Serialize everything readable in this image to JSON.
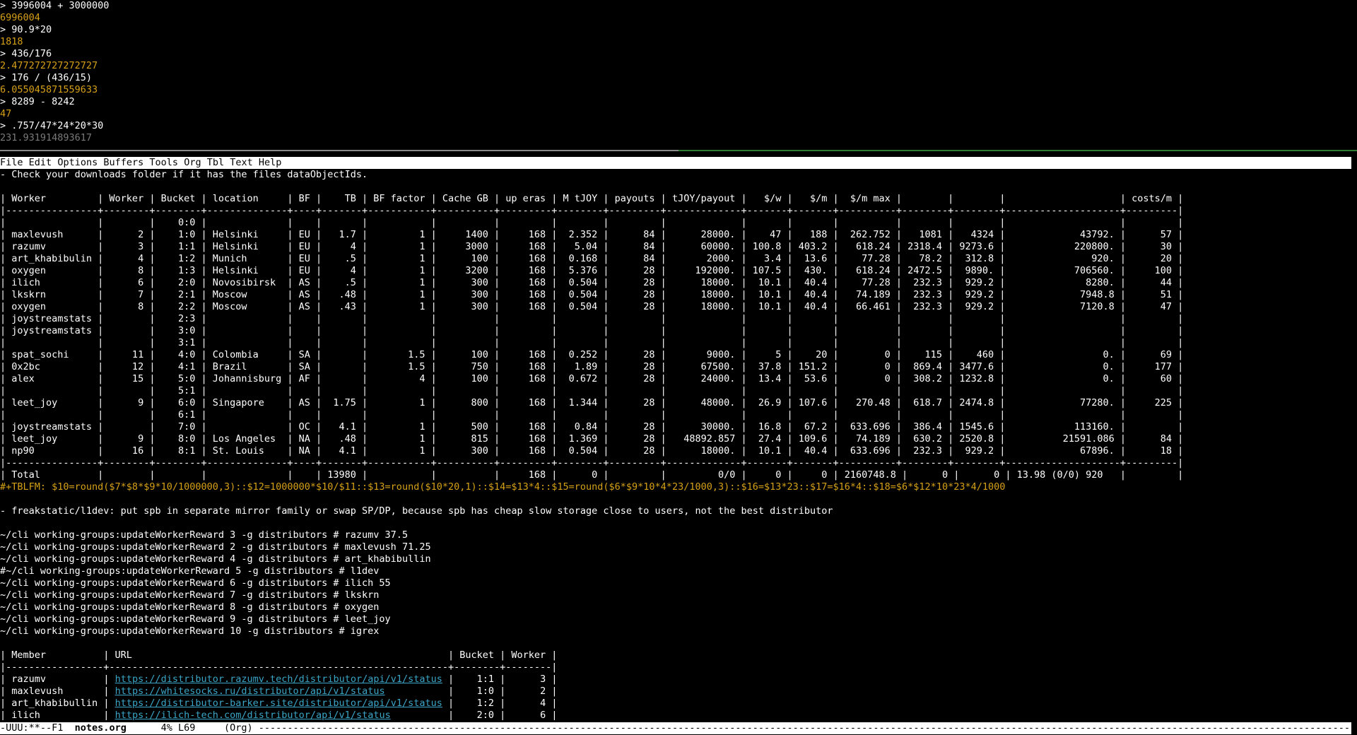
{
  "terminal": {
    "lines": [
      {
        "text": "> 3996004 + 3000000",
        "kind": "cmd"
      },
      {
        "text": "6996004",
        "kind": "out"
      },
      {
        "text": "> 90.9*20",
        "kind": "cmd"
      },
      {
        "text": "1818",
        "kind": "out"
      },
      {
        "text": "> 436/176",
        "kind": "cmd"
      },
      {
        "text": "2.477272727272727",
        "kind": "out"
      },
      {
        "text": "> 176 / (436/15)",
        "kind": "cmd"
      },
      {
        "text": "6.055045871559633",
        "kind": "out"
      },
      {
        "text": "> 8289 - 8242",
        "kind": "cmd"
      },
      {
        "text": "47",
        "kind": "out"
      },
      {
        "text": "> .757/47*24*20*30",
        "kind": "cmd"
      },
      {
        "text": "231.931914893617",
        "kind": "dim"
      }
    ]
  },
  "menubar": {
    "items": [
      "File",
      "Edit",
      "Options",
      "Buffers",
      "Tools",
      "Org",
      "Tbl",
      "Text",
      "Help"
    ]
  },
  "buffer": {
    "lines": [
      {
        "text": "- Check your downloads folder if it has the files dataObjectIds.",
        "kind": "text"
      },
      {
        "text": "",
        "kind": "text"
      },
      {
        "text": "| Worker         | Worker | Bucket | location     | BF |    TB | BF factor | Cache GB | up eras | M tJOY | payouts | tJOY/payout |   $/w |   $/m |  $/m max |        |        |                    | costs/m |",
        "kind": "tbl"
      },
      {
        "text": "|----------------+--------+--------+--------------+----+-------+-----------+----------+---------+--------+---------+-------------+-------+-------+----------+--------+--------+--------------------+---------|",
        "kind": "tbl"
      },
      {
        "text": "|                |        |    0:0 |              |    |       |           |          |         |        |         |             |       |       |          |        |        |                    |         |",
        "kind": "tbl"
      },
      {
        "text": "| maxlevush      |      2 |    1:0 | Helsinki     | EU |   1.7 |         1 |     1400 |     168 |  2.352 |      84 |      28000. |    47 |   188 |  262.752 |   1081 |   4324 |             43792. |      57 |",
        "kind": "tbl"
      },
      {
        "text": "| razumv         |      3 |    1:1 | Helsinki     | EU |     4 |         1 |     3000 |     168 |   5.04 |      84 |      60000. | 100.8 | 403.2 |   618.24 | 2318.4 | 9273.6 |            220800. |      30 |",
        "kind": "tbl"
      },
      {
        "text": "| art_khabibulin |      4 |    1:2 | Munich       | EU |    .5 |         1 |      100 |     168 |  0.168 |      84 |       2000. |   3.4 |  13.6 |    77.28 |   78.2 |  312.8 |               920. |      20 |",
        "kind": "tbl"
      },
      {
        "text": "| oxygen         |      8 |    1:3 | Helsinki     | EU |     4 |         1 |     3200 |     168 |  5.376 |      28 |     192000. | 107.5 |  430. |   618.24 | 2472.5 |  9890. |            706560. |     100 |",
        "kind": "tbl"
      },
      {
        "text": "| ilich          |      6 |    2:0 | Novosibirsk  | AS |    .5 |         1 |      300 |     168 |  0.504 |      28 |      18000. |  10.1 |  40.4 |    77.28 |  232.3 |  929.2 |              8280. |      44 |",
        "kind": "tbl"
      },
      {
        "text": "| lkskrn         |      7 |    2:1 | Moscow       | AS |   .48 |         1 |      300 |     168 |  0.504 |      28 |      18000. |  10.1 |  40.4 |   74.189 |  232.3 |  929.2 |             7948.8 |      51 |",
        "kind": "tbl"
      },
      {
        "text": "| oxygen         |      8 |    2:2 | Moscow       | AS |   .43 |         1 |      300 |     168 |  0.504 |      28 |      18000. |  10.1 |  40.4 |   66.461 |  232.3 |  929.2 |             7120.8 |      47 |",
        "kind": "tbl"
      },
      {
        "text": "| joystreamstats |        |    2:3 |              |    |       |           |          |         |        |         |             |       |       |          |        |        |                    |         |",
        "kind": "tbl"
      },
      {
        "text": "| joystreamstats |        |    3:0 |              |    |       |           |          |         |        |         |             |       |       |          |        |        |                    |         |",
        "kind": "tbl"
      },
      {
        "text": "|                |        |    3:1 |              |    |       |           |          |         |        |         |             |       |       |          |        |        |                    |         |",
        "kind": "tbl"
      },
      {
        "text": "| spat_sochi     |     11 |    4:0 | Colombia     | SA |       |       1.5 |      100 |     168 |  0.252 |      28 |       9000. |     5 |    20 |        0 |    115 |    460 |                 0. |      69 |",
        "kind": "tbl"
      },
      {
        "text": "| 0x2bc          |     12 |    4:1 | Brazil       | SA |       |       1.5 |      750 |     168 |   1.89 |      28 |      67500. |  37.8 | 151.2 |        0 |  869.4 | 3477.6 |                 0. |     177 |",
        "kind": "tbl"
      },
      {
        "text": "| alex           |     15 |    5:0 | Johannisburg | AF |       |         4 |      100 |     168 |  0.672 |      28 |      24000. |  13.4 |  53.6 |        0 |  308.2 | 1232.8 |                 0. |      60 |",
        "kind": "tbl"
      },
      {
        "text": "|                |        |    5:1 |              |    |       |           |          |         |        |         |             |       |       |          |        |        |                    |         |",
        "kind": "tbl"
      },
      {
        "text": "| leet_joy       |      9 |    6:0 | Singapore    | AS |  1.75 |         1 |      800 |     168 |  1.344 |      28 |      48000. |  26.9 | 107.6 |   270.48 |  618.7 | 2474.8 |             77280. |     225 |",
        "kind": "tbl"
      },
      {
        "text": "|                |        |    6:1 |              |    |       |           |          |         |        |         |             |       |       |          |        |        |                    |         |",
        "kind": "tbl"
      },
      {
        "text": "| joystreamstats |        |    7:0 |              | OC |   4.1 |         1 |      500 |     168 |   0.84 |      28 |      30000. |  16.8 |  67.2 |  633.696 |  386.4 | 1545.6 |            113160. |         |",
        "kind": "tbl"
      },
      {
        "text": "| leet_joy       |      9 |    8:0 | Los Angeles  | NA |   .48 |         1 |      815 |     168 |  1.369 |      28 |   48892.857 |  27.4 | 109.6 |   74.189 |  630.2 | 2520.8 |          21591.086 |      84 |",
        "kind": "tbl"
      },
      {
        "text": "| np90           |     16 |    8:1 | St. Louis    | NA |   4.1 |         1 |      300 |     168 |  0.504 |      28 |      18000. |  10.1 |  40.4 |  633.696 |  232.3 |  929.2 |             67896. |      18 |",
        "kind": "tbl"
      },
      {
        "text": "|----------------+--------+--------+--------------+----+-------+-----------+----------+---------+--------+---------+-------------+-------+-------+----------+--------+--------+--------------------+---------|",
        "kind": "tbl"
      },
      {
        "text": "| Total          |        |        |              |    | 13980 |           |          |     168 |      0 |         |         0/0 |     0 |     0 | 2160748.8 |      0 |      0 | 13.98 (0/0) 920   |         |",
        "kind": "tbl"
      },
      {
        "text": "#+TBLFM: $10=round($7*$8*$9*10/1000000,3)::$12=1000000*$10/$11::$13=round($10*20,1)::$14=$13*4::$15=round($6*$9*10*4*23/1000,3)::$16=$13*23::$17=$16*4::$18=$6*$12*10*23*4/1000",
        "kind": "formula"
      },
      {
        "text": "",
        "kind": "text"
      },
      {
        "text": "- freakstatic/l1dev: put spb in separate mirror family or swap SP/DP, because spb has cheap slow storage close to users, not the best distributor",
        "kind": "text"
      },
      {
        "text": "",
        "kind": "text"
      },
      {
        "text": "~/cli working-groups:updateWorkerReward 3 -g distributors # razumv 37.5",
        "kind": "text"
      },
      {
        "text": "~/cli working-groups:updateWorkerReward 2 -g distributors # maxlevush 71.25",
        "kind": "text"
      },
      {
        "text": "~/cli working-groups:updateWorkerReward 4 -g distributors # art_khabibullin",
        "kind": "text"
      },
      {
        "text": "#~/cli working-groups:updateWorkerReward 5 -g distributors # l1dev",
        "kind": "text"
      },
      {
        "text": "~/cli working-groups:updateWorkerReward 6 -g distributors # ilich 55",
        "kind": "text"
      },
      {
        "text": "~/cli working-groups:updateWorkerReward 7 -g distributors # lkskrn",
        "kind": "text"
      },
      {
        "text": "~/cli working-groups:updateWorkerReward 8 -g distributors # oxygen",
        "kind": "text"
      },
      {
        "text": "~/cli working-groups:updateWorkerReward 9 -g distributors # leet_joy",
        "kind": "text"
      },
      {
        "text": "~/cli working-groups:updateWorkerReward 10 -g distributors # igrex",
        "kind": "text"
      },
      {
        "text": "",
        "kind": "text"
      },
      {
        "text": "| Member          | URL                                                       | Bucket | Worker |",
        "kind": "tbl"
      },
      {
        "text": "|-----------------+-----------------------------------------------------------+--------+--------|",
        "kind": "tbl"
      }
    ],
    "url_rows": [
      {
        "member": "razumv",
        "url": "https://distributor.razumv.tech/distributor/api/v1/status",
        "bucket": "1:1",
        "worker": "3"
      },
      {
        "member": "maxlevush",
        "url": "https://whitesocks.ru/distributor/api/v1/status",
        "bucket": "1:0",
        "worker": "2"
      },
      {
        "member": "art_khabibullin",
        "url": "https://distributor-barker.site/distributor/api/v1/status",
        "bucket": "1:2",
        "worker": "4"
      },
      {
        "member": "ilich",
        "url": "https://ilich-tech.com/distributor/api/v1/status",
        "bucket": "2:0",
        "worker": "6"
      }
    ]
  },
  "modeline": {
    "status": "-UUU:**--F1  ",
    "buffer_name": "notes.org",
    "position": "      4% L69     (Org) ",
    "fill": "-----------------------------------------------------------------------------------------------------------------------------------------------------------------------------------------------"
  }
}
